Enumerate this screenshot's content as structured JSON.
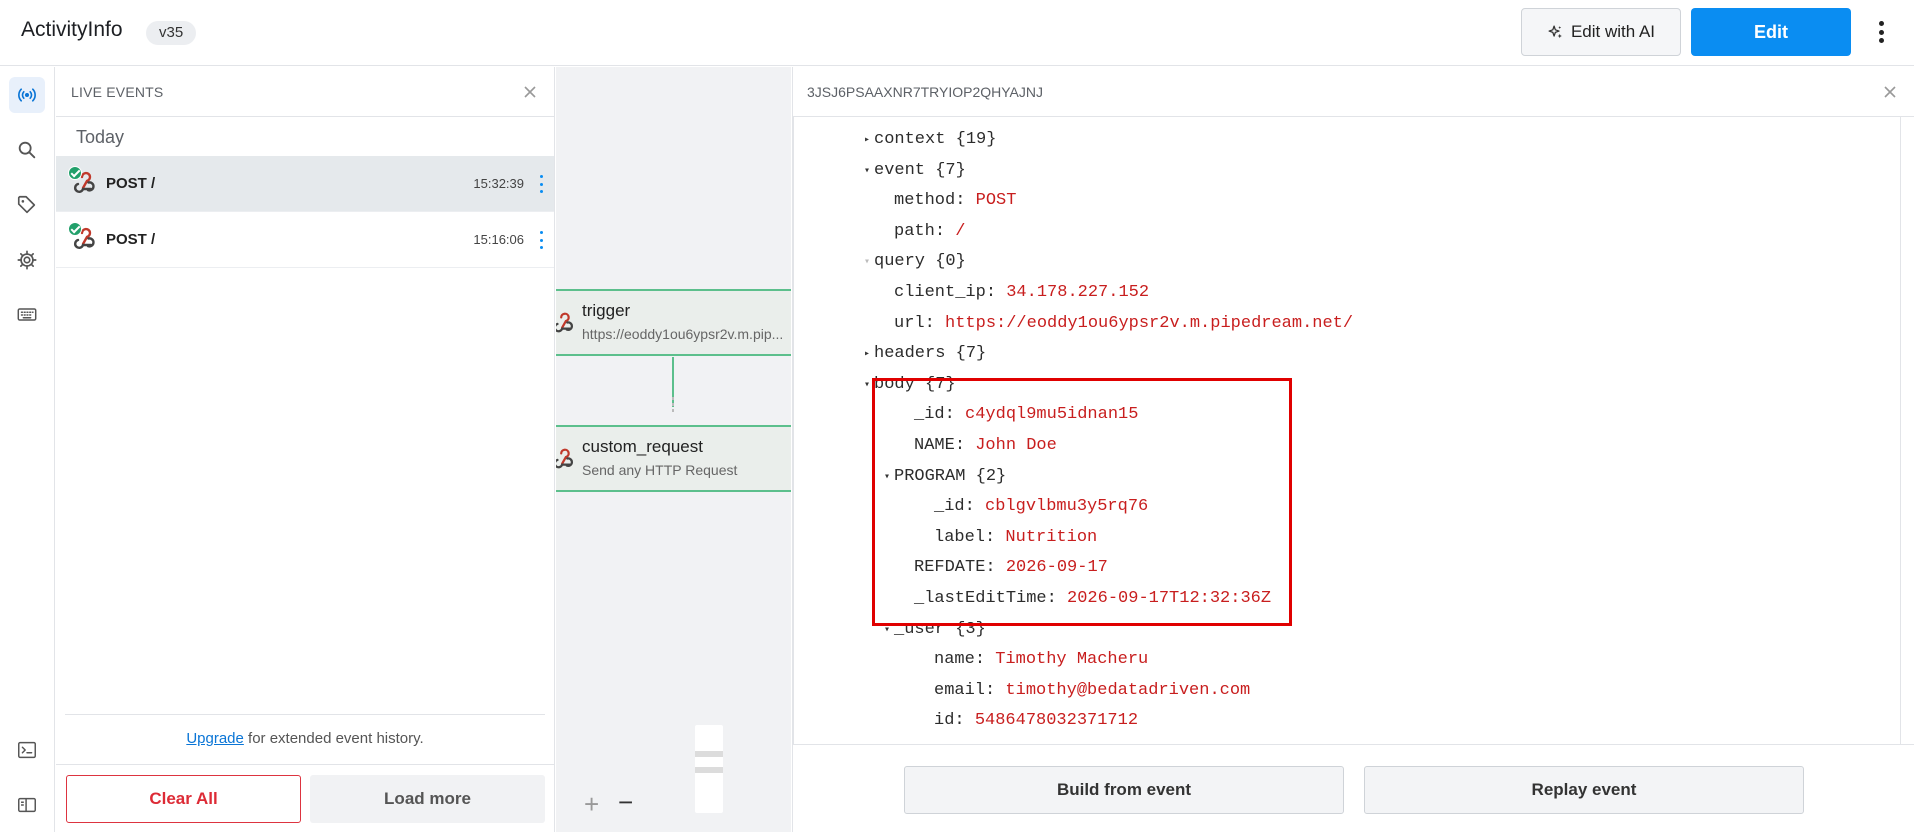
{
  "header": {
    "app_title": "ActivityInfo",
    "version": "v35",
    "edit_ai_label": "Edit with AI",
    "edit_label": "Edit"
  },
  "rail": {
    "items": [
      "live-events-icon",
      "search-icon",
      "tag-icon",
      "gear-icon",
      "keyboard-icon",
      "terminal-icon",
      "panel-icon"
    ],
    "active": "live-events-icon"
  },
  "events": {
    "title": "LIVE EVENTS",
    "group_label": "Today",
    "items": [
      {
        "label": "POST /",
        "time": "15:32:39",
        "status": "success",
        "selected": true
      },
      {
        "label": "POST /",
        "time": "15:16:06",
        "status": "success",
        "selected": false
      }
    ],
    "upgrade_link": "Upgrade",
    "upgrade_text": " for extended event history.",
    "clear_label": "Clear All",
    "load_label": "Load more"
  },
  "canvas": {
    "nodes": [
      {
        "title": "trigger",
        "subtitle": "https://eoddy1ou6ypsr2v.m.pip..."
      },
      {
        "title": "custom_request",
        "subtitle": "Send any HTTP Request"
      }
    ],
    "zoom_in": "+",
    "zoom_out": "−"
  },
  "detail": {
    "event_id": "3JSJ6PSAAXNR7TRYIOP2QHYAJNJ",
    "json": [
      {
        "caret": "right",
        "key": "context",
        "summary": "{19}"
      },
      {
        "caret": "down",
        "key": "event",
        "summary": "{7}"
      },
      {
        "key": "method",
        "value": "POST"
      },
      {
        "key": "path",
        "value": "/"
      },
      {
        "caret": "down-faint",
        "key": "query",
        "summary": "{0}"
      },
      {
        "key": "client_ip",
        "value": "34.178.227.152"
      },
      {
        "key": "url",
        "value": "https://eoddy1ou6ypsr2v.m.pipedream.net/"
      },
      {
        "caret": "right",
        "key": "headers",
        "summary": "{7}"
      },
      {
        "caret": "down",
        "key": "body",
        "summary": "{7}"
      },
      {
        "key": "_id",
        "value": "c4ydql9mu5idnan15"
      },
      {
        "key": "NAME",
        "value": "John Doe"
      },
      {
        "caret": "down",
        "key": "PROGRAM",
        "summary": "{2}"
      },
      {
        "key": "_id",
        "value": "cblgvlbmu3y5rq76"
      },
      {
        "key": "label",
        "value": "Nutrition"
      },
      {
        "key": "REFDATE",
        "value": "2026-09-17"
      },
      {
        "key": "_lastEditTime",
        "value": "2026-09-17T12:32:36Z"
      },
      {
        "caret": "down",
        "key": "_user",
        "summary": "{3}"
      },
      {
        "key": "name",
        "value": "Timothy Macheru"
      },
      {
        "key": "email",
        "value": "timothy@bedatadriven.com"
      },
      {
        "key": "id",
        "value": "5486478032371712"
      }
    ],
    "build_label": "Build from event",
    "replay_label": "Replay event"
  },
  "colors": {
    "accent": "#0a8df2",
    "danger": "#dd2b36",
    "json_value": "#c81e1e",
    "node_border": "#5cbf8c",
    "highlight": "#e00000"
  }
}
